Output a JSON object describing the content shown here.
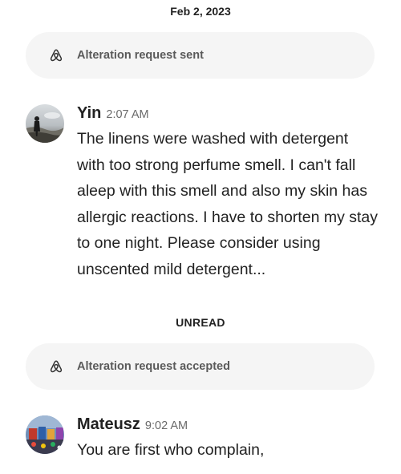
{
  "thread": {
    "date_separator": "Feb 2, 2023",
    "unread_label": "UNREAD",
    "events": [
      {
        "text": "Alteration request sent"
      },
      {
        "text": "Alteration request accepted"
      }
    ],
    "messages": [
      {
        "sender": "Yin",
        "time": "2:07 AM",
        "text": "The linens were washed with detergent with too strong perfume smell. I can't fall aleep with this smell and also my skin has allergic reactions. I have to shorten my stay to one night. Please consider using unscented mild detergent..."
      },
      {
        "sender": "Mateusz",
        "time": "9:02 AM",
        "text": "You are first who complain,"
      }
    ]
  },
  "icons": {
    "event_icon": "airbnb-logo-icon"
  },
  "colors": {
    "pill_background": "#f5f5f5",
    "primary_text": "#222222",
    "secondary_text": "#6a6a6a"
  }
}
